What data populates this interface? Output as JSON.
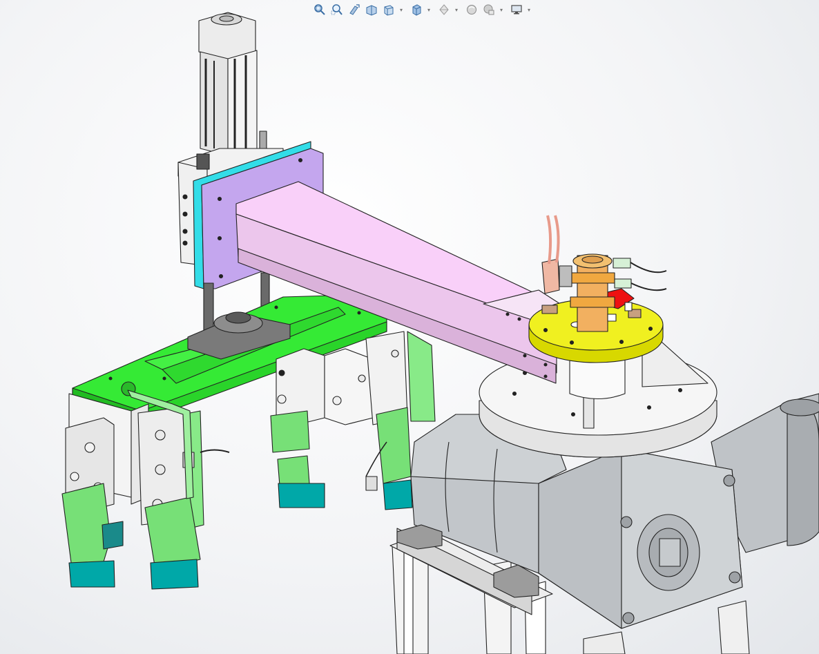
{
  "app": {
    "type": "cad-viewport",
    "background": "#f3f4f6"
  },
  "heads_up_toolbar": {
    "buttons": [
      {
        "name": "zoom-to-fit",
        "icon": "zoom-to-fit-icon"
      },
      {
        "name": "zoom-to-area",
        "icon": "zoom-to-area-icon"
      },
      {
        "name": "previous-view",
        "icon": "previous-view-icon"
      },
      {
        "name": "section-view",
        "icon": "section-view-icon"
      },
      {
        "name": "dynamic-annotation-views",
        "icon": "annotation-view-icon",
        "dropdown": true
      },
      {
        "name": "view-orientation",
        "icon": "view-orientation-icon",
        "dropdown": true
      },
      {
        "name": "display-style",
        "icon": "display-style-icon",
        "dropdown": true
      },
      {
        "name": "hide-show-items",
        "icon": "hide-show-icon",
        "dropdown": true
      },
      {
        "name": "edit-appearance",
        "icon": "appearance-icon",
        "dropdown": true
      },
      {
        "name": "view-settings",
        "icon": "monitor-icon",
        "dropdown": true
      }
    ]
  },
  "model_colors": {
    "gripper_plate": "#33ee33",
    "gripper_fingers": "#77e077",
    "finger_tips": "#00a8a8",
    "arm_beam": "#f4c8f4",
    "mount_plate": "#c8a8ee",
    "mount_edge": "#33e0ee",
    "rotary_disc": "#f0f020",
    "brass_collar": "#f0a850",
    "sensor_red": "#ee1111",
    "motor_gray": "#c4c8cc",
    "cylinder_white": "#f0f0f0"
  }
}
